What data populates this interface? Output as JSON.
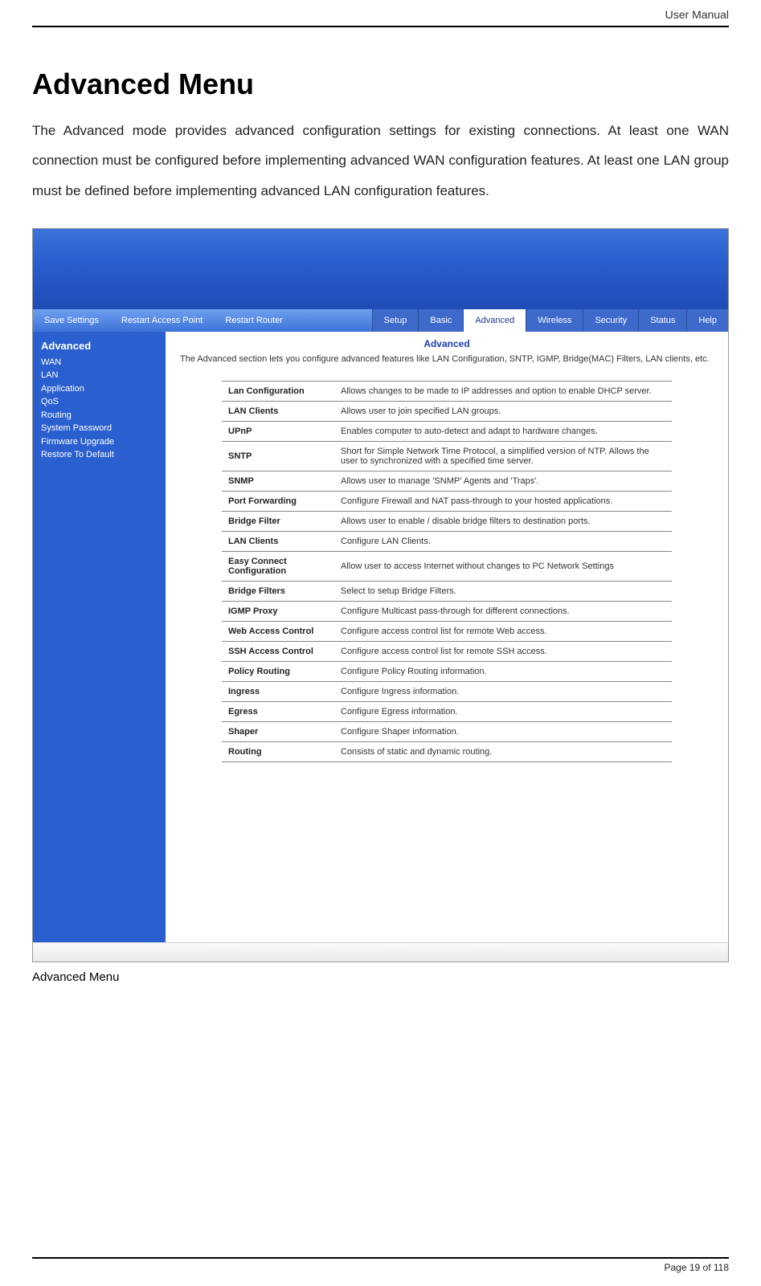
{
  "doc": {
    "header_right": "User Manual",
    "section_title": "Advanced Menu",
    "body_text": "The Advanced mode provides advanced configuration settings for existing connections. At least one WAN connection must be configured before implementing advanced WAN configuration features. At least one LAN group must be defined before implementing advanced LAN configuration features.",
    "caption": "Advanced Menu",
    "page_footer": "Page 19 of 118"
  },
  "router_ui": {
    "nav_left": {
      "save": "Save Settings",
      "restart_ap": "Restart Access Point",
      "restart_router": "Restart Router"
    },
    "tabs": {
      "setup": "Setup",
      "basic": "Basic",
      "advanced": "Advanced",
      "wireless": "Wireless",
      "security": "Security",
      "status": "Status",
      "help": "Help"
    },
    "sidebar": {
      "title": "Advanced",
      "items": [
        "WAN",
        "LAN",
        "Application",
        "QoS",
        "Routing",
        "System Password",
        "Firmware Upgrade",
        "Restore To Default"
      ]
    },
    "content": {
      "title": "Advanced",
      "desc": "The Advanced section lets you configure advanced features like LAN Configuration, SNTP, IGMP, Bridge(MAC) Filters, LAN clients, etc.",
      "rows": [
        {
          "k": "Lan Configuration",
          "v": "Allows changes to be made to IP addresses and option to enable DHCP server."
        },
        {
          "k": "LAN Clients",
          "v": "Allows user to join specified LAN groups."
        },
        {
          "k": "UPnP",
          "v": "Enables computer to auto-detect and adapt to hardware changes."
        },
        {
          "k": "SNTP",
          "v": "Short for Simple Network Time Protocol, a simplified version of NTP. Allows the user to synchronized with a specified time server."
        },
        {
          "k": "SNMP",
          "v": "Allows user to manage 'SNMP' Agents and 'Traps'."
        },
        {
          "k": "Port Forwarding",
          "v": "Configure Firewall and NAT pass-through to your hosted applications."
        },
        {
          "k": "Bridge Filter",
          "v": "Allows user to enable / disable bridge filters to destination ports."
        },
        {
          "k": "LAN Clients",
          "v": "Configure LAN Clients."
        },
        {
          "k": "Easy Connect Configuration",
          "v": "Allow user to access Internet without changes to PC Network Settings"
        },
        {
          "k": "Bridge Filters",
          "v": "Select to setup Bridge Filters."
        },
        {
          "k": "IGMP Proxy",
          "v": "Configure Multicast pass-through for different connections."
        },
        {
          "k": "Web Access Control",
          "v": "Configure access control list for remote Web access."
        },
        {
          "k": "SSH Access Control",
          "v": "Configure access control list for remote SSH access."
        },
        {
          "k": "Policy Routing",
          "v": "Configure Policy Routing information."
        },
        {
          "k": "Ingress",
          "v": "Configure Ingress information."
        },
        {
          "k": "Egress",
          "v": "Configure Egress information."
        },
        {
          "k": "Shaper",
          "v": "Configure Shaper information."
        },
        {
          "k": "Routing",
          "v": "Consists of static and dynamic routing."
        }
      ]
    }
  }
}
